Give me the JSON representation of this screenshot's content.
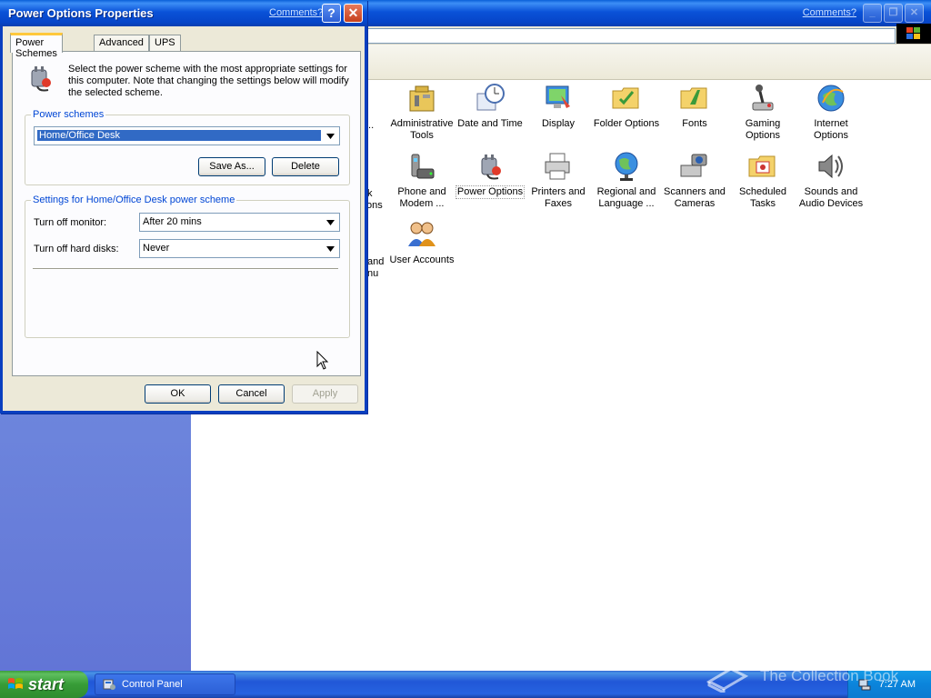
{
  "control_panel": {
    "comments_link": "Comments?",
    "icons": [
      {
        "label": "Administrative Tools",
        "icon": "administrative-tools-icon"
      },
      {
        "label": "Date and Time",
        "icon": "date-time-icon"
      },
      {
        "label": "Display",
        "icon": "display-icon"
      },
      {
        "label": "Folder Options",
        "icon": "folder-options-icon"
      },
      {
        "label": "Fonts",
        "icon": "fonts-icon"
      },
      {
        "label": "Gaming Options",
        "icon": "gaming-options-icon"
      },
      {
        "label": "Internet Options",
        "icon": "internet-options-icon"
      },
      {
        "label": "Phone and Modem ...",
        "icon": "phone-modem-icon"
      },
      {
        "label": "Power Options",
        "icon": "power-options-icon"
      },
      {
        "label": "Printers and Faxes",
        "icon": "printer-icon"
      },
      {
        "label": "Regional and Language ...",
        "icon": "globe-icon"
      },
      {
        "label": "Scanners and Cameras",
        "icon": "scanner-icon"
      },
      {
        "label": "Scheduled Tasks",
        "icon": "scheduled-tasks-icon"
      },
      {
        "label": "Sounds and Audio Devices",
        "icon": "speaker-icon"
      },
      {
        "label": "User Accounts",
        "icon": "user-accounts-icon"
      }
    ],
    "partial_labels": [
      "k",
      "ons",
      "...",
      "and",
      "nu"
    ]
  },
  "dialog": {
    "title": "Power Options Properties",
    "comments_link": "Comments?",
    "help_label": "?",
    "close_label": "✕",
    "tabs": [
      "Power Schemes",
      "Advanced",
      "UPS"
    ],
    "description": "Select the power scheme with the most appropriate settings for this computer. Note that changing the settings below will modify the selected scheme.",
    "power_schemes": {
      "legend": "Power schemes",
      "selected": "Home/Office Desk",
      "save_as_label": "Save As...",
      "delete_label": "Delete"
    },
    "settings": {
      "legend": "Settings for Home/Office Desk power scheme",
      "turn_off_monitor_label": "Turn off monitor:",
      "turn_off_monitor_value": "After 20 mins",
      "turn_off_disks_label": "Turn off hard disks:",
      "turn_off_disks_value": "Never"
    },
    "ok_label": "OK",
    "cancel_label": "Cancel",
    "apply_label": "Apply"
  },
  "taskbar": {
    "start_label": "start",
    "task_label": "Control Panel",
    "clock": "7:27 AM",
    "watermark": "The Collection Book"
  },
  "colors": {
    "titlebar_blue": "#0a52d8",
    "dialog_face": "#ece9d8",
    "sidepane": "#6c84dc",
    "start_green": "#379c37",
    "selection": "#316ac5"
  }
}
